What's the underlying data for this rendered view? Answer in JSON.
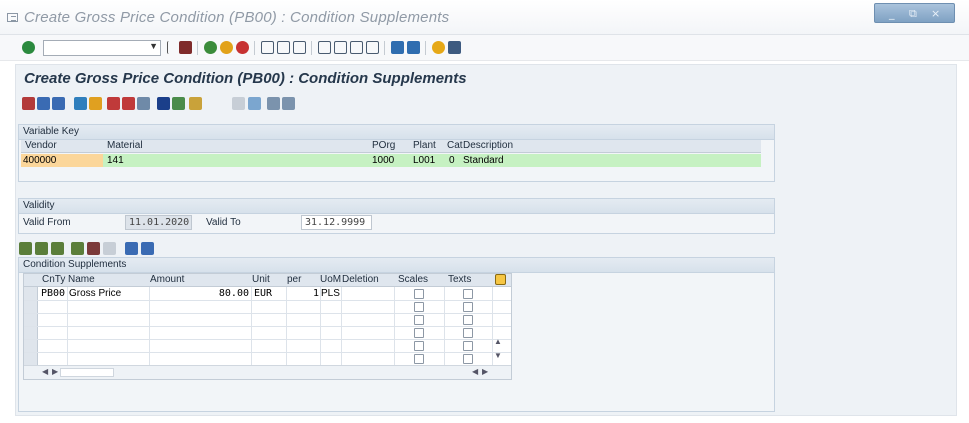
{
  "window": {
    "title": "Create Gross Price Condition (PB00) : Condition Supplements",
    "controls": [
      "_",
      "⧉",
      "×"
    ]
  },
  "screen_title": "Create Gross Price Condition (PB00) : Condition Supplements",
  "variable_key": {
    "header": "Variable Key",
    "columns": [
      "Vendor",
      "Material",
      "POrg",
      "Plant",
      "Cat",
      "Description"
    ],
    "row": {
      "vendor": "400000",
      "material": "141",
      "porg": "1000",
      "plant": "L001",
      "cat": "0",
      "description": "Standard"
    },
    "colors": {
      "vendor_bg": "#fbd69a",
      "row_bg": "#c6f1c2"
    }
  },
  "validity": {
    "header": "Validity",
    "valid_from_label": "Valid From",
    "valid_from": "11.01.2020",
    "valid_to_label": "Valid To",
    "valid_to": "31.12.9999"
  },
  "supplements": {
    "header": "Condition Supplements",
    "columns": [
      "CnTy",
      "Name",
      "Amount",
      "Unit",
      "per",
      "UoM",
      "Deletion",
      "Scales",
      "Texts"
    ],
    "rows": [
      {
        "cnty": "PB00",
        "name": "Gross Price",
        "amount": "80.00",
        "unit": "EUR",
        "per": "1",
        "uom": "PLS"
      }
    ]
  },
  "colors": {
    "accent": "#26384c",
    "window_bg": "#eef2f6"
  }
}
